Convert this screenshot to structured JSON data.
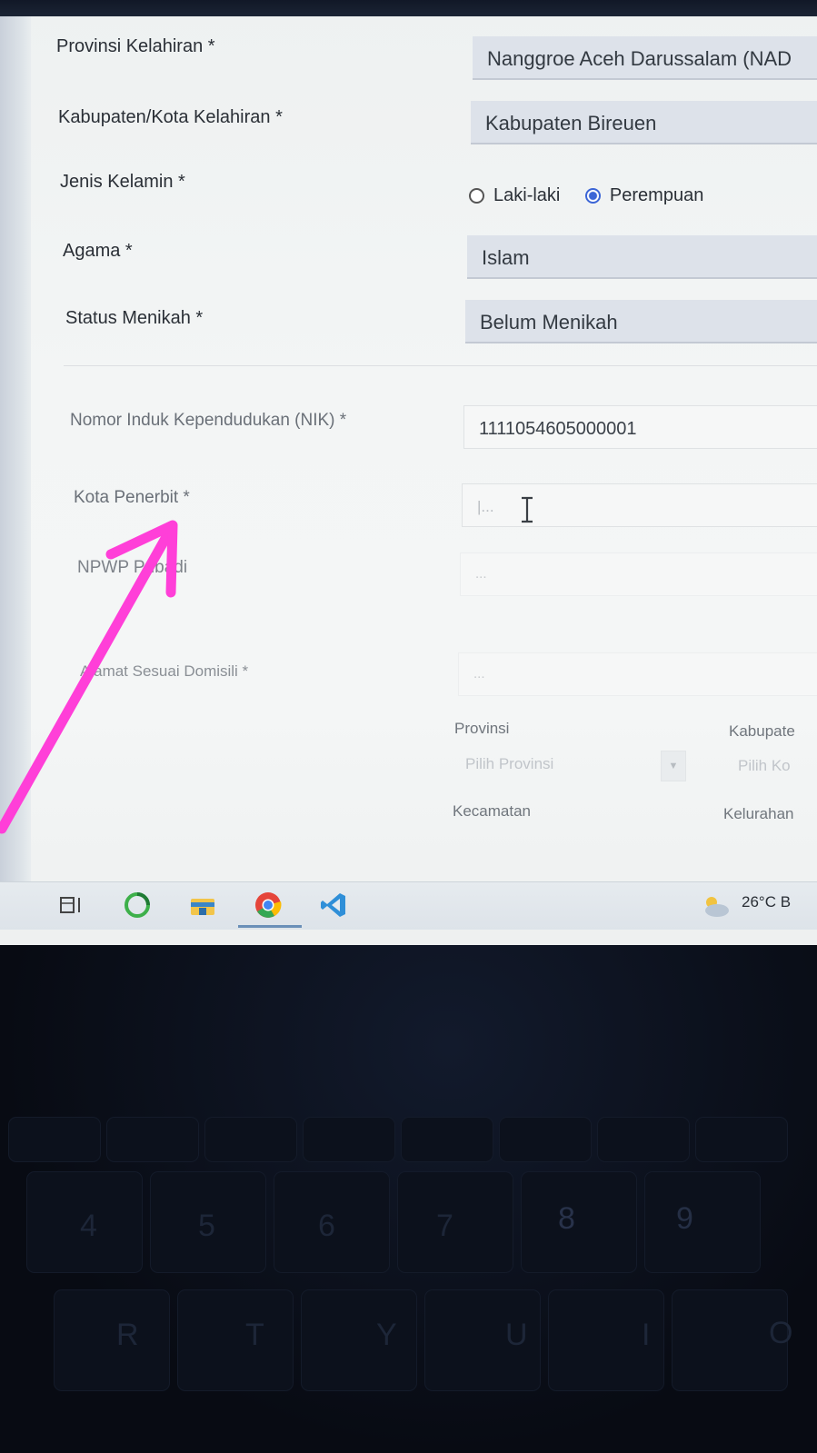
{
  "form": {
    "provinsi_kelahiran": {
      "label": "Provinsi Kelahiran *",
      "value": "Nanggroe Aceh Darussalam (NAD"
    },
    "kabupaten_kelahiran": {
      "label": "Kabupaten/Kota Kelahiran *",
      "value": "Kabupaten Bireuen"
    },
    "jenis_kelamin": {
      "label": "Jenis Kelamin *",
      "options": [
        "Laki-laki",
        "Perempuan"
      ],
      "selected": "Perempuan"
    },
    "agama": {
      "label": "Agama *",
      "value": "Islam"
    },
    "status_menikah": {
      "label": "Status Menikah *",
      "value": "Belum Menikah"
    },
    "nik": {
      "label": "Nomor Induk Kependudukan (NIK) *",
      "value": "1111054605000001"
    },
    "kota_penerbit": {
      "label": "Kota Penerbit *",
      "placeholder": "|..."
    },
    "npwp": {
      "label": "NPWP Pribadi",
      "placeholder": "..."
    },
    "alamat": {
      "label": "Alamat Sesuai Domisili *",
      "placeholder": "..."
    },
    "provinsi": {
      "label": "Provinsi",
      "placeholder": "Pilih Provinsi"
    },
    "kabupaten": {
      "label": "Kabupate",
      "placeholder": "Pilih Ko"
    },
    "kecamatan": {
      "label": "Kecamatan"
    },
    "kelurahan": {
      "label": "Kelurahan"
    }
  },
  "taskbar": {
    "icons": [
      "task-view-icon",
      "circle-app-icon",
      "file-explorer-icon",
      "chrome-icon",
      "vscode-icon"
    ],
    "weather": "26°C B"
  },
  "keyboard": {
    "keys": [
      "4",
      "5",
      "6",
      "7",
      "8",
      "9",
      "R",
      "T",
      "Y",
      "U",
      "I",
      "O"
    ]
  },
  "colors": {
    "annotation_arrow": "#ff3fd8",
    "radio_selected": "#3b65d6"
  }
}
